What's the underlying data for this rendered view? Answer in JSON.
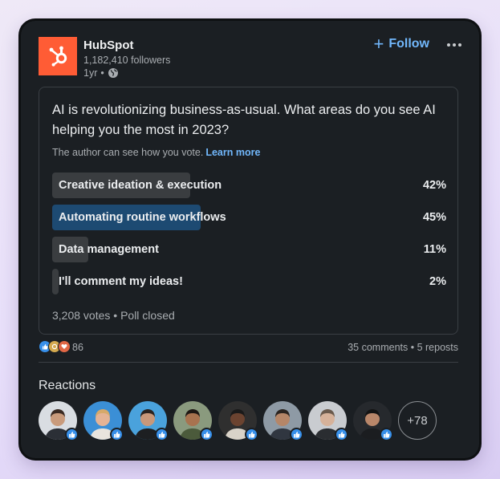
{
  "post": {
    "company": "HubSpot",
    "followers": "1,182,410 followers",
    "age": "1yr",
    "separator": "•",
    "logo_color": "#ff5c35",
    "follow": {
      "icon": "plus-icon",
      "label": "Follow"
    },
    "more_icon": "more-options-icon",
    "visibility_icon": "globe-icon"
  },
  "poll": {
    "question": "AI is revolutionizing business-as-usual. What areas do you see AI helping you the most in 2023?",
    "note": "The author can see how you vote.",
    "learn_more": "Learn more",
    "options": [
      {
        "label": "Creative ideation & execution",
        "percent_text": "42%",
        "percent": 42,
        "leading": false
      },
      {
        "label": "Automating routine workflows",
        "percent_text": "45%",
        "percent": 45,
        "leading": true
      },
      {
        "label": "Data management",
        "percent_text": "11%",
        "percent": 11,
        "leading": false
      },
      {
        "label": "I'll comment my ideas!",
        "percent_text": "2%",
        "percent": 2,
        "leading": false
      }
    ],
    "footer": "3,208 votes • Poll closed",
    "leading_color": "#1d4a72",
    "bar_color": "#3a3d40"
  },
  "social": {
    "reaction_icons": [
      "like-icon",
      "celebrate-icon",
      "love-icon"
    ],
    "reaction_count": "86",
    "counts": "35 comments • 5 reposts"
  },
  "reactions": {
    "title": "Reactions",
    "avatars": [
      {
        "name": "reactor-avatar-1",
        "bg": "#d9dde2",
        "skin": "#c99b7c",
        "hair": "#3a2a22",
        "shirt": "#2b2f36"
      },
      {
        "name": "reactor-avatar-2",
        "bg": "#3b8fd6",
        "skin": "#e4b395",
        "hair": "#d6a96a",
        "shirt": "#e8e4de"
      },
      {
        "name": "reactor-avatar-3",
        "bg": "#4aa2dc",
        "skin": "#c8987a",
        "hair": "#2a2320",
        "shirt": "#1d1f22"
      },
      {
        "name": "reactor-avatar-4",
        "bg": "#8a9a7e",
        "skin": "#a8734f",
        "hair": "#1e1814",
        "shirt": "#4b5a3b"
      },
      {
        "name": "reactor-avatar-5",
        "bg": "#2f2f2f",
        "skin": "#6b4330",
        "hair": "#1a1a1a",
        "shirt": "#d8d2c8"
      },
      {
        "name": "reactor-avatar-6",
        "bg": "#8e9aa5",
        "skin": "#b58668",
        "hair": "#2b2420",
        "shirt": "#303640"
      },
      {
        "name": "reactor-avatar-7",
        "bg": "#c9ccd0",
        "skin": "#d6b29a",
        "hair": "#6a5a4c",
        "shirt": "#2a2d31"
      },
      {
        "name": "reactor-avatar-8",
        "bg": "#26292d",
        "skin": "#b9876a",
        "hair": "#141414",
        "shirt": "#1b1d20"
      }
    ],
    "badge_icon": "like-icon",
    "more_label": "+78"
  }
}
